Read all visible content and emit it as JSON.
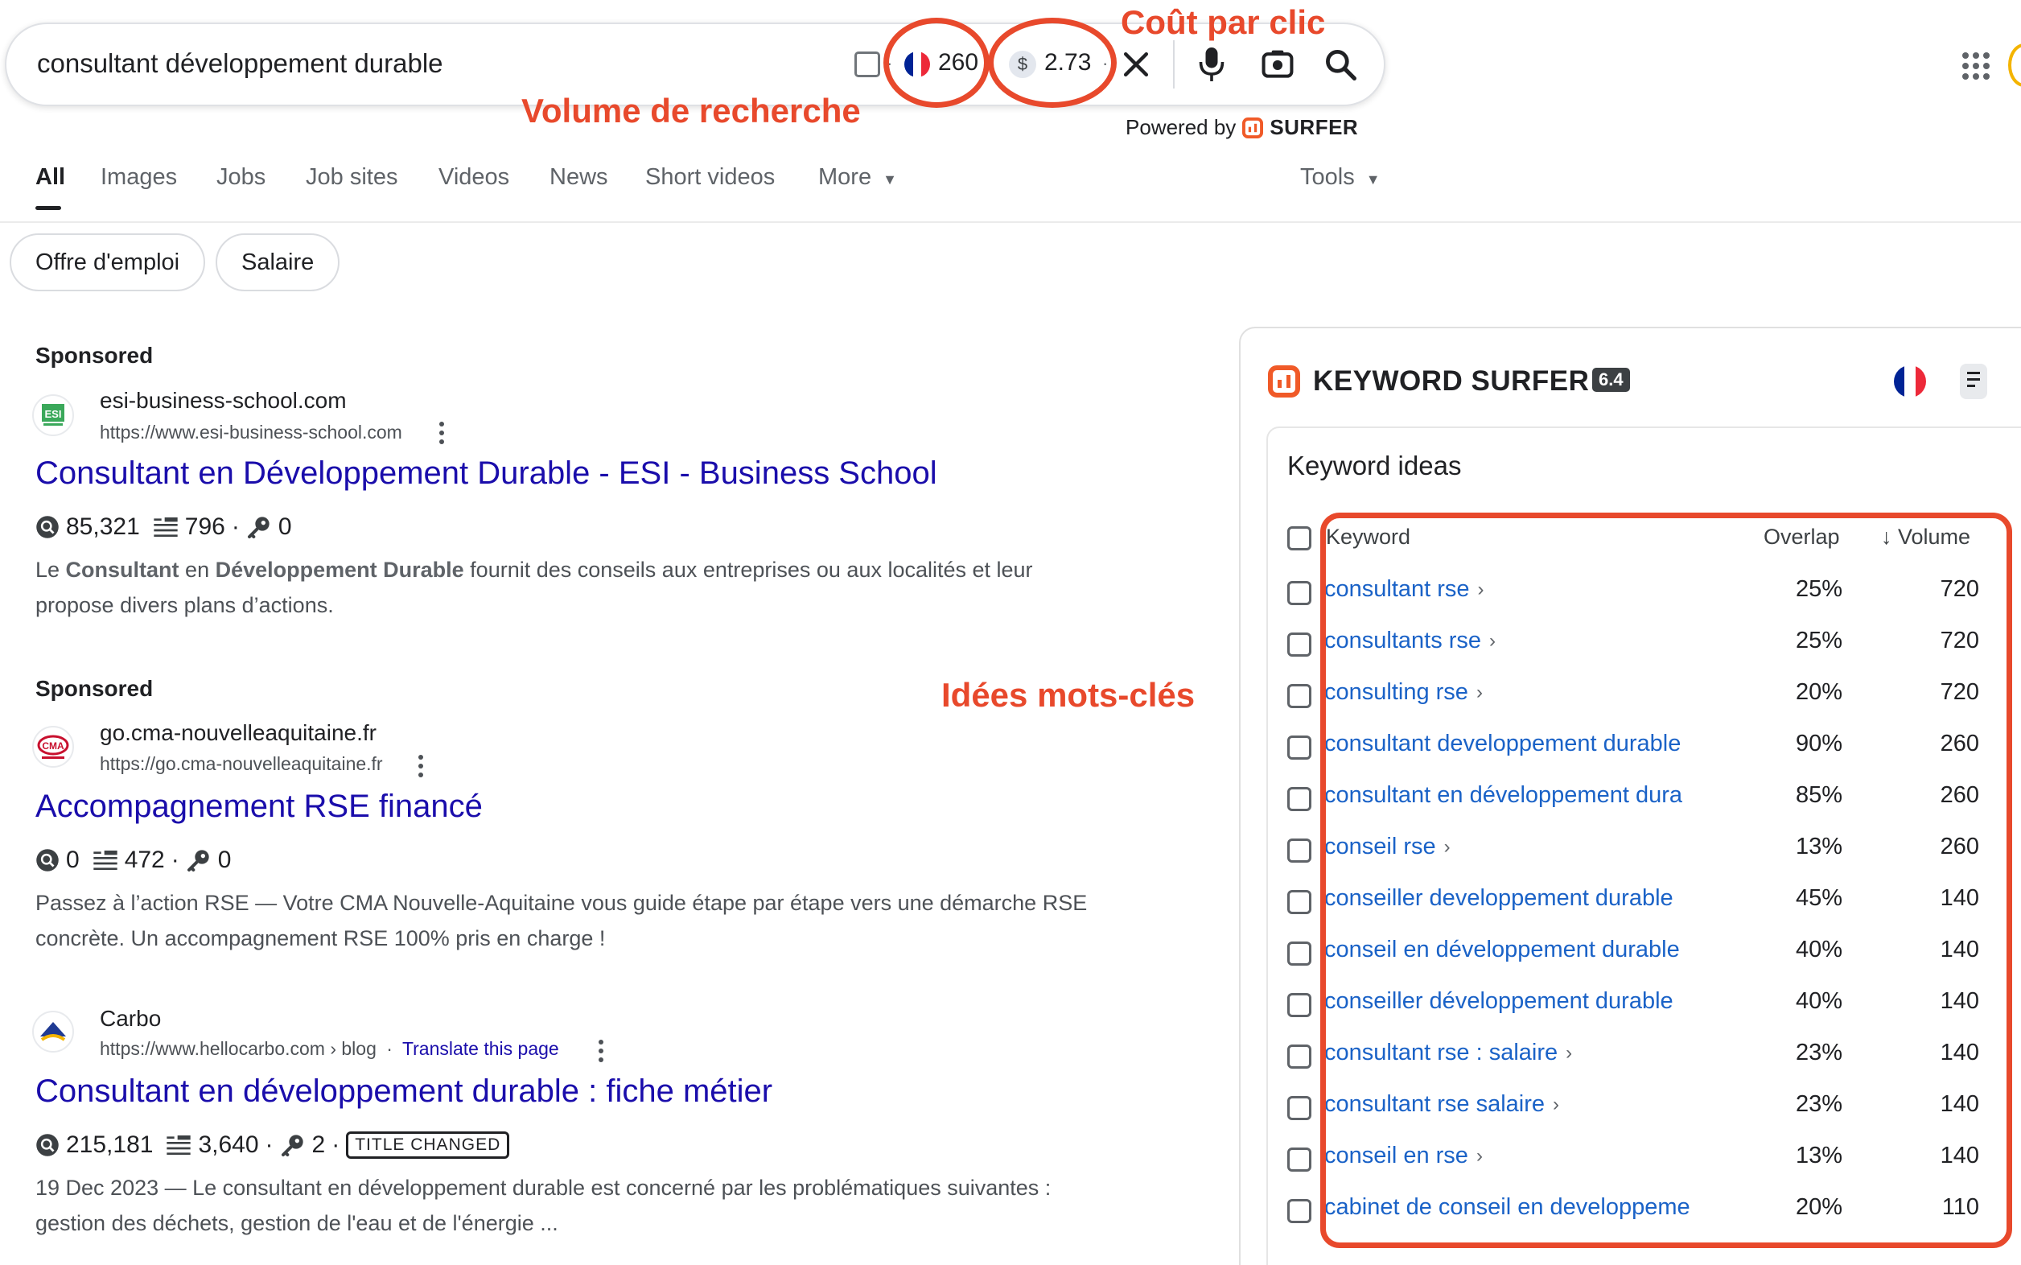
{
  "search": {
    "query": "consultant développement durable",
    "search_volume": "260",
    "cpc": "2.73",
    "currency_symbol": "$",
    "separator": "·",
    "powered_by": "Powered by",
    "surfer_brand": "SURFER"
  },
  "annotations": {
    "volume_label": "Volume de recherche",
    "cpc_label": "Coût par clic",
    "ideas_label": "Idées mots-clés",
    "color": "#e8492c"
  },
  "tabs": [
    {
      "label": "All"
    },
    {
      "label": "Images"
    },
    {
      "label": "Jobs"
    },
    {
      "label": "Job sites"
    },
    {
      "label": "Videos"
    },
    {
      "label": "News"
    },
    {
      "label": "Short videos"
    },
    {
      "label": "More"
    }
  ],
  "tools_label": "Tools",
  "chips": [
    "Offre d'emploi",
    "Salaire"
  ],
  "results": [
    {
      "sponsored": "Sponsored",
      "site": "esi-business-school.com",
      "url": "https://www.esi-business-school.com",
      "title": "Consultant en Développement Durable - ESI - Business School",
      "m1": "85,321",
      "m2": "796",
      "m3": "0",
      "snippet_a": "Le ",
      "snippet_b": "Consultant",
      "snippet_c": " en ",
      "snippet_d": "Développement Durable",
      "snippet_e": " fournit des conseils aux entreprises ou aux localités et leur propose divers plans d’actions."
    },
    {
      "sponsored": "Sponsored",
      "site": "go.cma-nouvelleaquitaine.fr",
      "url": "https://go.cma-nouvelleaquitaine.fr",
      "title": "Accompagnement RSE financé",
      "m1": "0",
      "m2": "472",
      "m3": "0",
      "snippet": "Passez à l’action RSE — Votre CMA Nouvelle-Aquitaine vous guide étape par étape vers une démarche RSE concrète. Un accompagnement RSE 100% pris en charge !"
    },
    {
      "site": "Carbo",
      "url": "https://www.hellocarbo.com › blog",
      "translate": "Translate this page",
      "title": "Consultant en développement durable : fiche métier",
      "m1": "215,181",
      "m2": "3,640",
      "m3": "2",
      "badge": "TITLE CHANGED",
      "snippet": "19 Dec 2023 — Le consultant en développement durable est concerné par les problématiques suivantes : gestion des déchets, gestion de l'eau et de l'énergie ..."
    }
  ],
  "surfer": {
    "title": "KEYWORD SURFER",
    "version": "6.4",
    "ideas_title": "Keyword ideas",
    "col_keyword": "Keyword",
    "col_overlap": "Overlap",
    "col_volume": "↓ Volume",
    "keywords": [
      {
        "kw": "consultant rse",
        "chevron": "›",
        "overlap": "25%",
        "volume": "720"
      },
      {
        "kw": "consultants rse",
        "chevron": "›",
        "overlap": "25%",
        "volume": "720"
      },
      {
        "kw": "consulting rse",
        "chevron": "›",
        "overlap": "20%",
        "volume": "720"
      },
      {
        "kw": "consultant developpement durable",
        "chevron": "",
        "overlap": "90%",
        "volume": "260"
      },
      {
        "kw": "consultant en développement dura",
        "chevron": "",
        "overlap": "85%",
        "volume": "260"
      },
      {
        "kw": "conseil rse",
        "chevron": "›",
        "overlap": "13%",
        "volume": "260"
      },
      {
        "kw": "conseiller developpement durable",
        "chevron": "",
        "overlap": "45%",
        "volume": "140"
      },
      {
        "kw": "conseil en développement durable",
        "chevron": "",
        "overlap": "40%",
        "volume": "140"
      },
      {
        "kw": "conseiller développement durable",
        "chevron": "",
        "overlap": "40%",
        "volume": "140"
      },
      {
        "kw": "consultant rse : salaire",
        "chevron": "›",
        "overlap": "23%",
        "volume": "140"
      },
      {
        "kw": "consultant rse salaire",
        "chevron": "›",
        "overlap": "23%",
        "volume": "140"
      },
      {
        "kw": "conseil en rse",
        "chevron": "›",
        "overlap": "13%",
        "volume": "140"
      },
      {
        "kw": "cabinet de conseil en developpeme",
        "chevron": "",
        "overlap": "20%",
        "volume": "110"
      }
    ]
  },
  "colors": {
    "link_blue": "#1a0dab",
    "keyword_blue": "#1a62c7",
    "surfer_orange": "#f05a28",
    "flag_blue": "#002395",
    "flag_red": "#ed2939"
  }
}
